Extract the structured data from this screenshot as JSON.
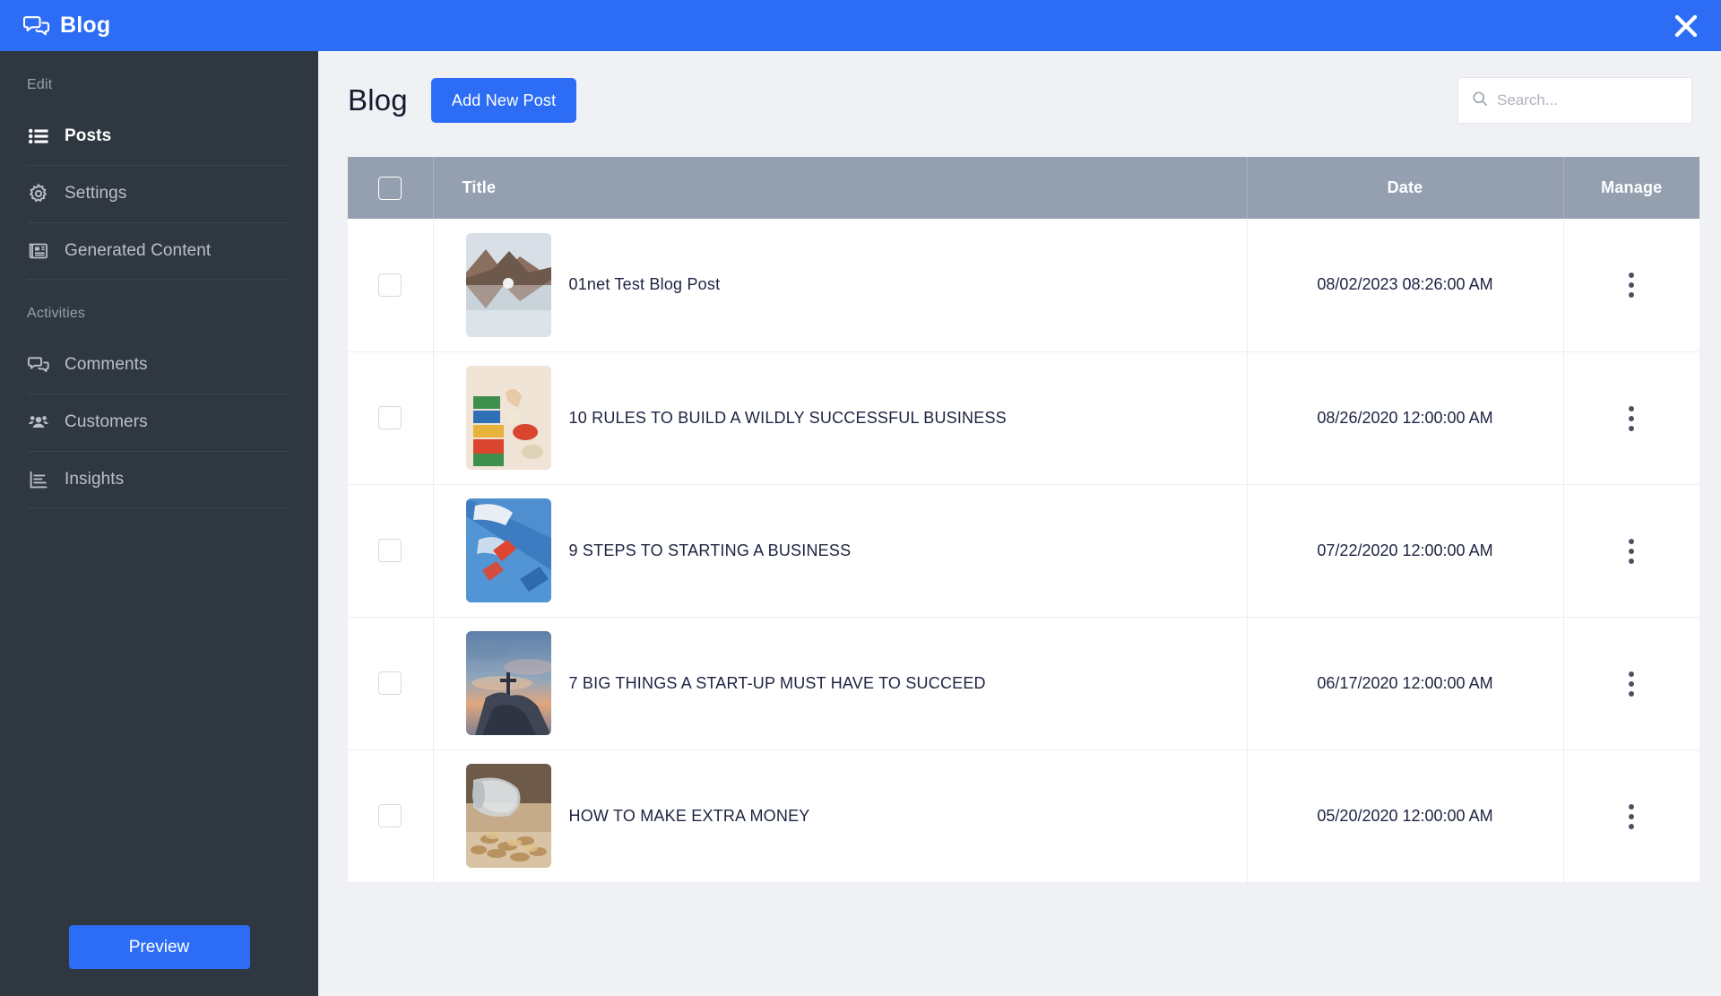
{
  "window": {
    "title": "Blog",
    "title_icon": "chat-bubbles-icon",
    "close_icon": "close-icon",
    "accent_color": "#2d6df6",
    "sidebar_color": "#2f3841",
    "table_header_color": "#94a0b0"
  },
  "sidebar": {
    "groups": [
      {
        "label": "Edit",
        "items": [
          {
            "label": "Posts",
            "icon": "list-icon",
            "active": true
          },
          {
            "label": "Settings",
            "icon": "gear-icon",
            "active": false
          },
          {
            "label": "Generated Content",
            "icon": "newspaper-icon",
            "active": false
          }
        ]
      },
      {
        "label": "Activities",
        "items": [
          {
            "label": "Comments",
            "icon": "chat-bubbles-icon",
            "active": false
          },
          {
            "label": "Customers",
            "icon": "people-icon",
            "active": false
          },
          {
            "label": "Insights",
            "icon": "bar-chart-icon",
            "active": false
          }
        ]
      }
    ],
    "preview_label": "Preview"
  },
  "main": {
    "page_title": "Blog",
    "add_button_label": "Add New Post",
    "search": {
      "placeholder": "Search...",
      "value": "",
      "icon": "search-icon"
    },
    "table": {
      "headers": {
        "select": "",
        "title": "Title",
        "date": "Date",
        "manage": "Manage"
      },
      "rows": [
        {
          "title": "01net Test Blog Post",
          "date": "08/02/2023 08:26:00 AM",
          "thumbnail": "mountain-lake-reflection-thumbnail",
          "selected": false
        },
        {
          "title": "10 RULES TO BUILD A WILDLY SUCCESSFUL BUSINESS",
          "date": "08/26/2020 12:00:00 AM",
          "thumbnail": "colored-blocks-thumbnail",
          "selected": false
        },
        {
          "title": "9 STEPS TO STARTING A BUSINESS",
          "date": "07/22/2020 12:00:00 AM",
          "thumbnail": "blue-running-shoe-thumbnail",
          "selected": false
        },
        {
          "title": "7 BIG THINGS A START-UP MUST HAVE TO SUCCEED",
          "date": "06/17/2020 12:00:00 AM",
          "thumbnail": "cliff-statue-sunset-thumbnail",
          "selected": false
        },
        {
          "title": "HOW TO MAKE EXTRA MONEY",
          "date": "05/20/2020 12:00:00 AM",
          "thumbnail": "coin-jar-thumbnail",
          "selected": false
        }
      ]
    }
  }
}
